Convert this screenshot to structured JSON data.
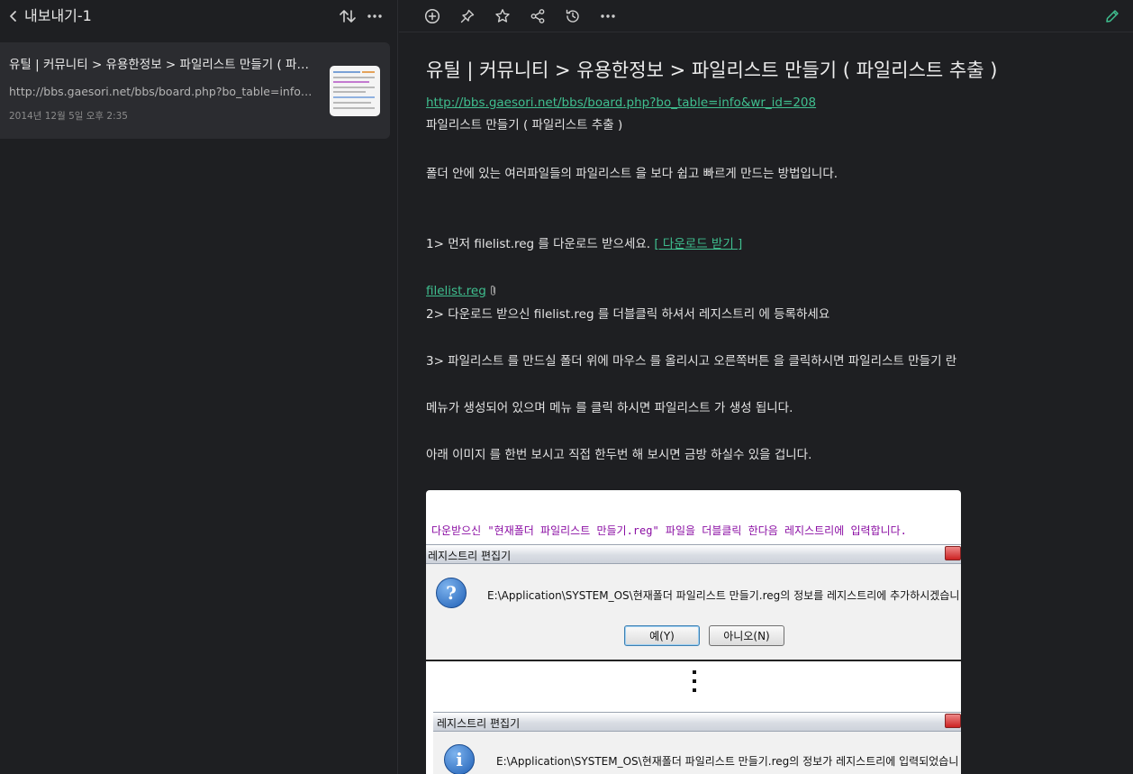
{
  "left_panel": {
    "notebook_title": "내보내기-1",
    "icons": {
      "back": "chevron-left-icon",
      "sort": "sort-arrows-icon",
      "more": "more-horizontal-icon"
    },
    "note": {
      "title": "유틸 | 커뮤니티 > 유용한정보 > 파일리스트 만들기 ( 파일리스트 추출 )",
      "url_preview": "http://bbs.gaesori.net/bbs/board.php?bo_table=info&wr_id=208",
      "date": "2014년 12월 5일 오후 2:35"
    }
  },
  "toolbar": {
    "icons": [
      "add-circle-icon",
      "pin-icon",
      "star-icon",
      "share-icon",
      "history-icon",
      "more-horizontal-icon",
      "edit-pencil-icon"
    ]
  },
  "document": {
    "title": "유틸 | 커뮤니티 > 유용한정보 > 파일리스트 만들기 ( 파일리스트 추출 )",
    "source_link": "http://bbs.gaesori.net/bbs/board.php?bo_table=info&wr_id=208",
    "subtitle": "파일리스트 만들기 ( 파일리스트 추출 )",
    "intro": "폴더 안에 있는 여러파일들의 파일리스트 을 보다 쉽고 빠르게 만드는 방법입니다.",
    "step1": "1> 먼저 filelist.reg 를 다운로드 받으세요.",
    "download_link": "[ 다운로드 받기 ]",
    "attachment": "filelist.reg",
    "step2": "2> 다운로드 받으신 filelist.reg 를 더블클릭 하셔서 레지스트리 에 등록하세요",
    "step3": "3> 파일리스트 를 만드실 폴더 위에 마우스 를 올리시고 오른쪽버튼 을 클릭하시면 파일리스트 만들기 란",
    "step3b": "메뉴가 생성되어 있으며 메뉴 를 클릭 하시면 파일리스트 가 생성 됩니다.",
    "outro": "아래 이미지 를 한번 보시고 직접 한두번 해 보시면 금방 하실수 있을 겁니다.",
    "image": {
      "caption": "다운받으신 \"현재폴더 파일리스트 만들기.reg\" 파일을 더블클릭 한다음 레지스트리에 입력합니다.",
      "dialog1_title": "레지스트리 편집기",
      "dialog1_message": "E:\\Application\\SYSTEM_OS\\현재폴더 파일리스트 만들기.reg의 정보를 레지스트리에 추가하시겠습니",
      "yes_button": "예(Y)",
      "no_button": "아니오(N)",
      "dialog2_title": "레지스트리 편집기",
      "dialog2_message": "E:\\Application\\SYSTEM_OS\\현재폴더 파일리스트 만들기.reg의 정보가 레지스트리에 입력되었습니"
    }
  },
  "colors": {
    "background": "#1e1f22",
    "card": "#2b2c30",
    "link": "#3fbf8f",
    "caption": "#8a0da3"
  }
}
